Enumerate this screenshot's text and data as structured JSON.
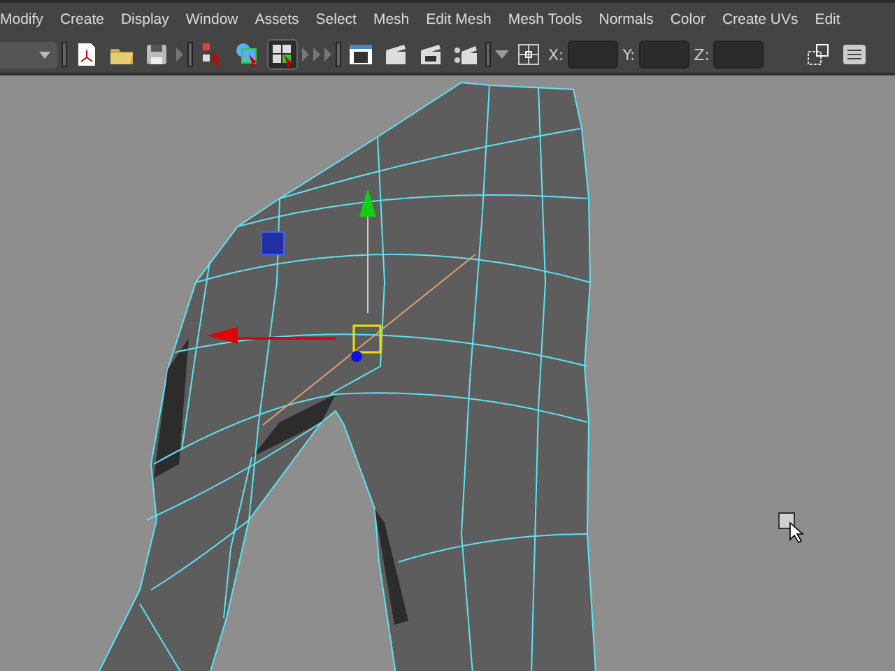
{
  "menu_bar": {
    "items": [
      "Modify",
      "Create",
      "Display",
      "Window",
      "Assets",
      "Select",
      "Mesh",
      "Edit Mesh",
      "Mesh Tools",
      "Normals",
      "Color",
      "Create UVs",
      "Edit"
    ]
  },
  "toolbar": {
    "selection_buttons": [
      {
        "selected": false
      },
      {
        "selected": false
      },
      {
        "selected": true
      }
    ],
    "coordinate_fields": [
      {
        "label": "X:"
      },
      {
        "label": "Y:"
      },
      {
        "label": "Z:"
      }
    ]
  }
}
